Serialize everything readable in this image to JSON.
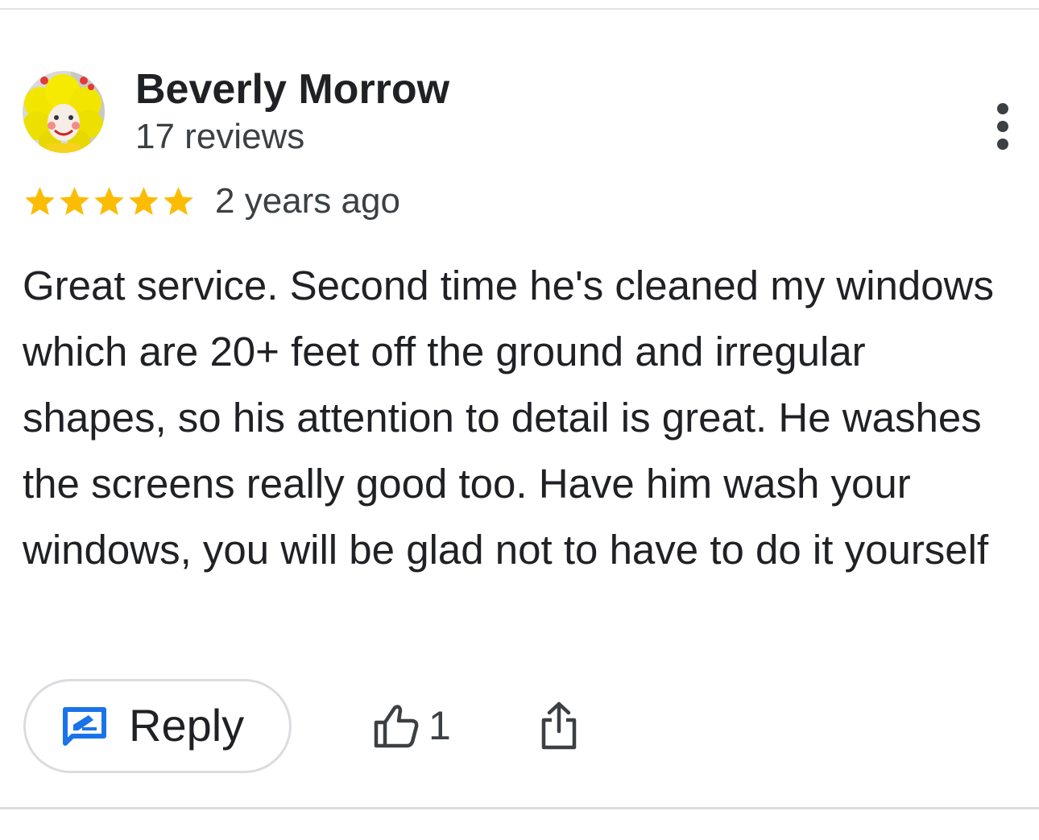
{
  "review": {
    "author": {
      "name": "Beverly Morrow",
      "meta": "17 reviews",
      "avatar_icon": "clown-avatar"
    },
    "rating": 5,
    "rating_max": 5,
    "date": "2 years ago",
    "text": "Great service. Second time he's cleaned my windows which are 20+ feet off the ground and irregular shapes, so his attention to detail is great. He washes the screens really good too. Have him wash your windows, you will be glad not to have to do it yourself"
  },
  "actions": {
    "reply_label": "Reply",
    "like_count": "1",
    "reply_icon": "reply-edit-icon",
    "like_icon": "thumbs-up-icon",
    "share_icon": "share-icon",
    "more_icon": "more-vertical-icon"
  },
  "colors": {
    "star": "#fbbc04",
    "accent": "#1a73e8",
    "text_primary": "#202124",
    "text_secondary": "#3c4043",
    "divider": "#dadce0"
  }
}
